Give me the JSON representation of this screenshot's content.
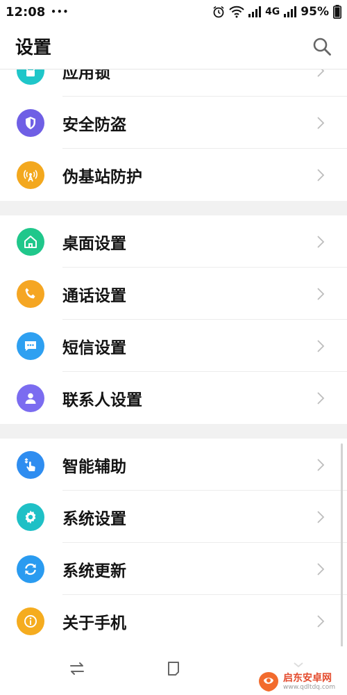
{
  "status": {
    "time": "12:08",
    "more": "•••",
    "network": "4G",
    "battery": "95%"
  },
  "header": {
    "title": "设置"
  },
  "sections": [
    [
      {
        "label": "应用锁",
        "icon": "lock-icon",
        "color": "#1fc6c9",
        "name": "applock"
      },
      {
        "label": "安全防盗",
        "icon": "shield-icon",
        "color": "#6f5fe5",
        "name": "security"
      },
      {
        "label": "伪基站防护",
        "icon": "antenna-icon",
        "color": "#f3a81e",
        "name": "fake-base-station"
      }
    ],
    [
      {
        "label": "桌面设置",
        "icon": "home-icon",
        "color": "#20c78b",
        "name": "desktop"
      },
      {
        "label": "通话设置",
        "icon": "phone-icon",
        "color": "#f5a623",
        "name": "call"
      },
      {
        "label": "短信设置",
        "icon": "message-icon",
        "color": "#2ea0f1",
        "name": "sms"
      },
      {
        "label": "联系人设置",
        "icon": "contact-icon",
        "color": "#7b6cf0",
        "name": "contacts"
      }
    ],
    [
      {
        "label": "智能辅助",
        "icon": "gesture-icon",
        "color": "#2f8df0",
        "name": "smart-assist"
      },
      {
        "label": "系统设置",
        "icon": "gear-icon",
        "color": "#1fc0c6",
        "name": "system-settings"
      },
      {
        "label": "系统更新",
        "icon": "refresh-icon",
        "color": "#2a9bf0",
        "name": "system-update"
      },
      {
        "label": "关于手机",
        "icon": "info-icon",
        "color": "#f5ac1f",
        "name": "about-phone"
      }
    ]
  ],
  "watermark": {
    "text": "启东安卓网",
    "url": "www.qdltdq.com"
  }
}
